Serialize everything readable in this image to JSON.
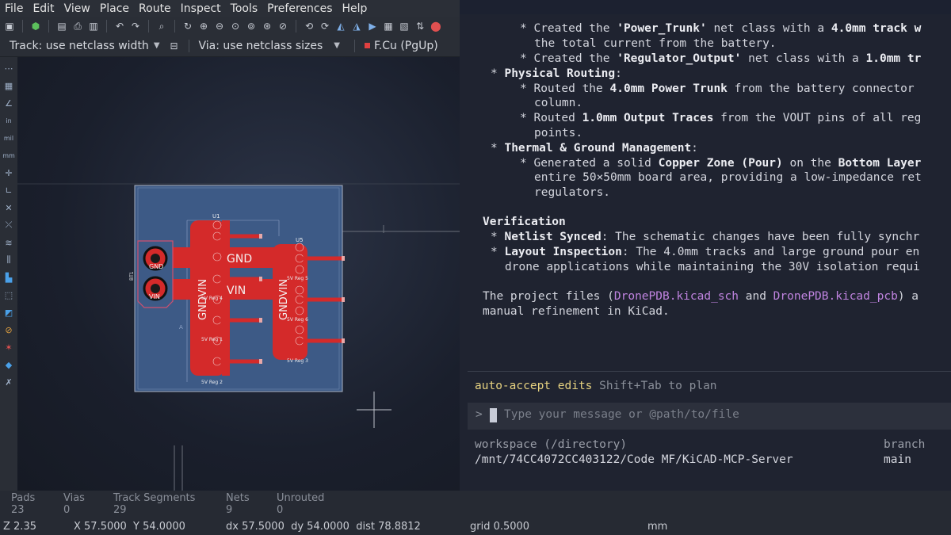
{
  "menu": [
    "File",
    "Edit",
    "View",
    "Place",
    "Route",
    "Inspect",
    "Tools",
    "Preferences",
    "Help"
  ],
  "toolbar2": {
    "track": "Track: use netclass width",
    "via": "Via: use netclass sizes",
    "layer": "F.Cu (PgUp)"
  },
  "pcb": {
    "u1": "U1",
    "u5": "U5",
    "bt1": "BT1",
    "gnd_pad": "GND",
    "vin_pad": "VIN",
    "net_gnd": "GND",
    "net_vin": "VIN",
    "gndvin_left": "GNDVIN",
    "gndvin_right": "GNDVIN",
    "reg1": "5V Reg 1",
    "reg2": "5V Reg 2",
    "reg3": "5V Reg 3",
    "reg4": "5V Reg 4",
    "reg5": "5V Reg 5",
    "reg6": "5V Reg 6",
    "small_a": "A"
  },
  "terminal": {
    "l1a": "* Created the ",
    "l1b": "'Power_Trunk'",
    "l1c": " net class with a ",
    "l1d": "4.0mm track w",
    "l2": "the total current from the battery.",
    "l3a": "* Created the ",
    "l3b": "'Regulator_Output'",
    "l3c": " net class with a ",
    "l3d": "1.0mm tr",
    "l4a": "* ",
    "l4b": "Physical Routing",
    "l4c": ":",
    "l5a": "* Routed the ",
    "l5b": "4.0mm Power Trunk",
    "l5c": " from the battery connector",
    "l6": "column.",
    "l7a": "* Routed ",
    "l7b": "1.0mm Output Traces",
    "l7c": " from the VOUT pins of all reg",
    "l8": "points.",
    "l9a": "* ",
    "l9b": "Thermal & Ground Management",
    "l9c": ":",
    "l10a": "* Generated a solid ",
    "l10b": "Copper Zone (Pour)",
    "l10c": " on the ",
    "l10d": "Bottom Layer",
    "l11": "entire 50×50mm board area, providing a low-impedance ret",
    "l12": "regulators.",
    "l13": "Verification",
    "l14a": "* ",
    "l14b": "Netlist Synced",
    "l14c": ": The schematic changes have been fully synchr",
    "l15a": "* ",
    "l15b": "Layout Inspection",
    "l15c": ": The 4.0mm tracks and large ground pour en",
    "l16": "drone applications while maintaining the 30V isolation requi",
    "l17a": "The project files (",
    "l17b": "DronePDB.kicad_sch",
    "l17c": " and ",
    "l17d": "DronePDB.kicad_pcb",
    "l17e": ") a",
    "l18": "manual refinement in KiCad.",
    "auto_accept": "auto-accept edits",
    "shift_tab": " Shift+Tab to plan",
    "prompt": ">",
    "placeholder": "Type your message or @path/to/file",
    "workspace_label": "workspace (/directory)",
    "workspace_path": "/mnt/74CC4072CC403122/Code MF/KiCAD-MCP-Server",
    "branch_label": "branch",
    "branch_value": "main"
  },
  "stats": [
    {
      "k": "Pads",
      "v": "23"
    },
    {
      "k": "Vias",
      "v": "0"
    },
    {
      "k": "Track Segments",
      "v": "29"
    },
    {
      "k": "Nets",
      "v": "9"
    },
    {
      "k": "Unrouted",
      "v": "0"
    }
  ],
  "coords": {
    "zoom": "Z 2.35",
    "xy": "X 57.5000  Y 54.0000",
    "delta": "dx 57.5000  dy 54.0000  dist 78.8812",
    "grid": "grid 0.5000",
    "units": "mm"
  },
  "colors": {
    "copper": "#d42a2a",
    "board": "#3d5a86",
    "terminal_bg": "#1f2330",
    "link": "#c084e0",
    "accent_yellow": "#e6d280"
  }
}
